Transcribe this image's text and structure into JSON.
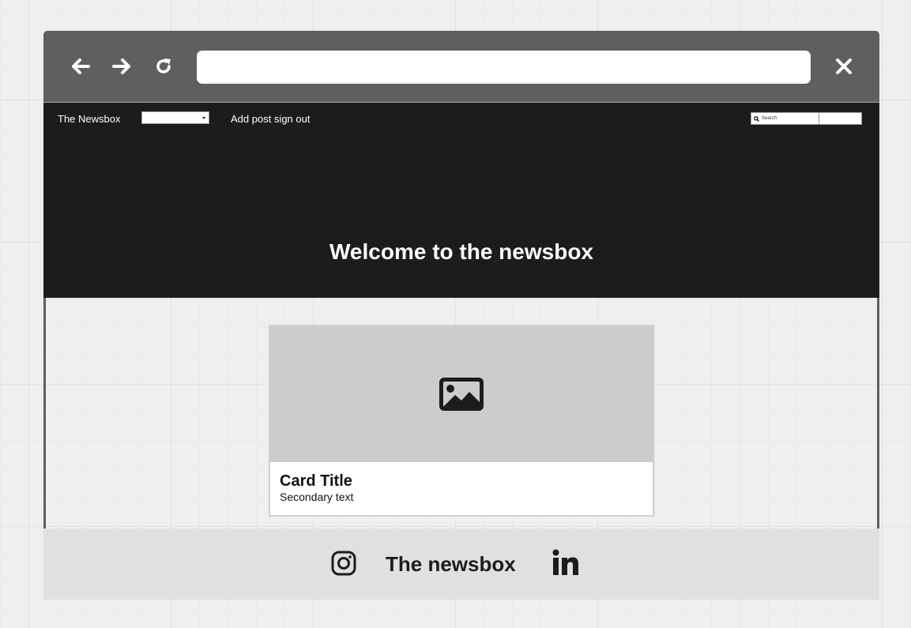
{
  "browser": {
    "address_value": "",
    "icons": {
      "back": "arrow-left-icon",
      "forward": "arrow-right-icon",
      "reload": "reload-icon",
      "close": "close-icon"
    }
  },
  "navbar": {
    "brand": "The Newsbox",
    "dropdown_selected": "",
    "links_text": "Add post sign out",
    "search_placeholder": "Search",
    "search_button_label": ""
  },
  "hero": {
    "title": "Welcome to the newsbox"
  },
  "card": {
    "image_icon": "image-icon",
    "title": "Card Title",
    "secondary": "Secondary text"
  },
  "footer": {
    "title": "The newsbox",
    "icons": [
      "instagram-icon",
      "linkedin-icon"
    ]
  },
  "colors": {
    "chrome": "#5f5f5f",
    "header": "#1c1c1c",
    "footer": "#e0e0e0",
    "card_image": "#cccccc"
  }
}
